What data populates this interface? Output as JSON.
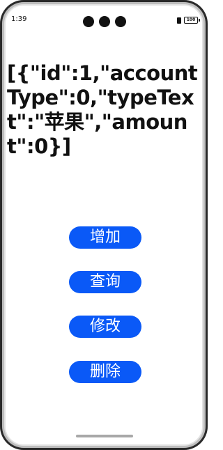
{
  "status_bar": {
    "time": "1:39",
    "battery_level": "100"
  },
  "content": {
    "json_text": "[{\"id\":1,\"accountType\":0,\"typeText\":\"苹果\",\"amount\":0}]"
  },
  "buttons": {
    "add_label": "增加",
    "query_label": "查询",
    "modify_label": "修改",
    "delete_label": "删除"
  },
  "colors": {
    "button_bg": "#0a59f7",
    "button_text": "#ffffff",
    "text": "#111111"
  }
}
